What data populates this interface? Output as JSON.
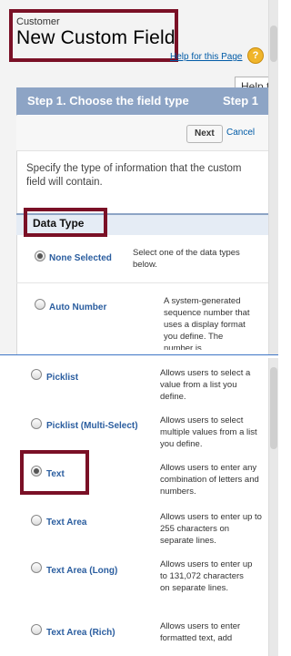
{
  "header": {
    "object_label": "Customer",
    "page_title": "New Custom Field",
    "help_link": "Help for this Page",
    "help_icon": "question-icon",
    "tooltip": "Help fo"
  },
  "step": {
    "title": "Step 1. Choose the field type",
    "number": "Step 1",
    "next_label": "Next",
    "cancel_label": "Cancel"
  },
  "instruction": "Specify the type of information that the custom field will contain.",
  "section": {
    "label": "Data Type"
  },
  "top_options": [
    {
      "label": "None Selected",
      "desc": "Select one of the data types below.",
      "selected": true
    },
    {
      "label": "Auto Number",
      "desc": "A system-generated sequence number that uses a display format you define. The number is",
      "selected": false
    }
  ],
  "bottom_options": [
    {
      "label": "Picklist",
      "desc": "Allows users to select a value from a list you define.",
      "selected": false
    },
    {
      "label": "Picklist (Multi-Select)",
      "desc": "Allows users to select multiple values from a list you define.",
      "selected": false
    },
    {
      "label": "Text",
      "desc": "Allows users to enter any combination of letters and numbers.",
      "selected": true
    },
    {
      "label": "Text Area",
      "desc": "Allows users to enter up to 255 characters on separate lines.",
      "selected": false
    },
    {
      "label": "Text Area (Long)",
      "desc": "Allows users to enter up to 131,072 characters on separate lines.",
      "selected": false
    },
    {
      "label": "Text Area (Rich)",
      "desc": "Allows users to enter formatted text, add",
      "selected": false
    }
  ],
  "colors": {
    "accent": "#8da4c5",
    "highlight": "#7a1026",
    "link": "#015ba7"
  }
}
